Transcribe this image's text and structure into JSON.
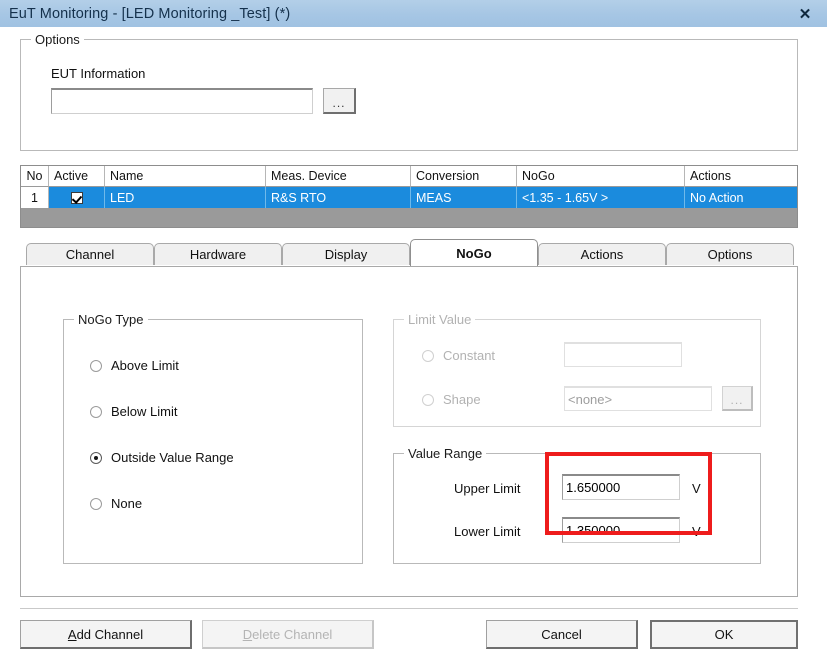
{
  "window": {
    "title": "EuT Monitoring  -  [LED Monitoring _Test] (*)",
    "close_icon": "✕",
    "titlebar_color": "#a6c6e4"
  },
  "options_group": {
    "title": "Options",
    "eut_information_label": "EUT Information",
    "eut_information_value": "",
    "eut_information_placeholder": "",
    "browse_label": "..."
  },
  "channel_table": {
    "columns": [
      "No",
      "Active",
      "Name",
      "Meas. Device",
      "Conversion",
      "NoGo",
      "Actions"
    ],
    "rows": [
      {
        "no": "1",
        "active": true,
        "name": "LED",
        "meas_device": "R&S RTO",
        "conversion": "MEAS",
        "nogo": "<1.35 - 1.65V >",
        "actions": "No Action",
        "selected": true
      }
    ],
    "selection_color": "#1b8bdd"
  },
  "tabs": [
    {
      "label": "Channel",
      "active": false
    },
    {
      "label": "Hardware",
      "active": false
    },
    {
      "label": "Display",
      "active": false
    },
    {
      "label": "NoGo",
      "active": true
    },
    {
      "label": "Actions",
      "active": false
    },
    {
      "label": "Options",
      "active": false
    }
  ],
  "nogo_type_group": {
    "title": "NoGo Type",
    "options": [
      {
        "label": "Above Limit",
        "checked": false
      },
      {
        "label": "Below Limit",
        "checked": false
      },
      {
        "label": "Outside Value Range",
        "checked": true
      },
      {
        "label": "None",
        "checked": false
      }
    ]
  },
  "limit_value_group": {
    "title": "Limit Value",
    "enabled": false,
    "constant_label": "Constant",
    "constant_checked": false,
    "constant_value": "",
    "shape_label": "Shape",
    "shape_checked": false,
    "shape_value": "<none>",
    "shape_browse_label": "..."
  },
  "value_range_group": {
    "title": "Value Range",
    "upper_limit_label": "Upper Limit",
    "upper_limit_value": "1.650000",
    "upper_limit_unit": "V",
    "lower_limit_label": "Lower Limit",
    "lower_limit_value": "1.350000",
    "lower_limit_unit": "V",
    "highlight_color": "#ee1c1c"
  },
  "footer": {
    "add_channel": "dd Channel",
    "add_channel_accel": "A",
    "delete_channel": "elete Channel",
    "delete_channel_accel": "D",
    "cancel": "Cancel",
    "ok": "OK"
  }
}
